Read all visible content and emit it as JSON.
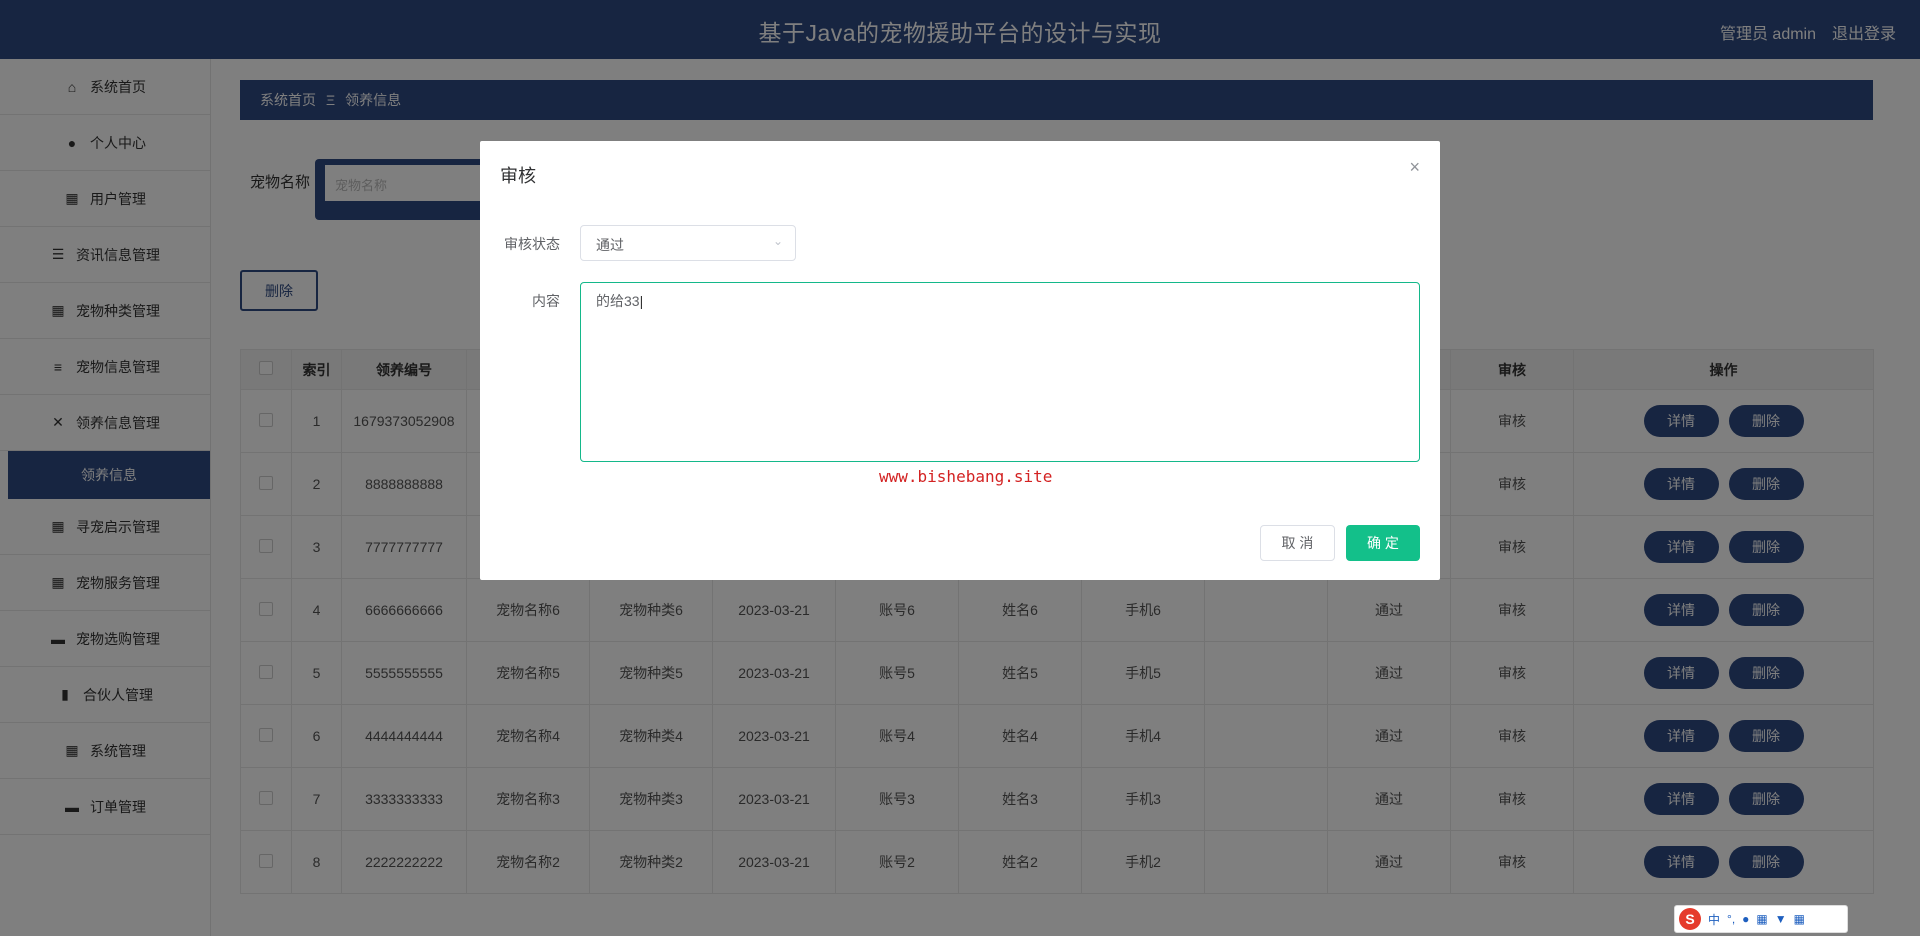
{
  "header": {
    "title": "基于Java的宠物援助平台的设计与实现",
    "user": "管理员 admin",
    "logout": "退出登录"
  },
  "sidebar": {
    "items": [
      {
        "label": "系统首页",
        "icon": "home-icon",
        "glyph": "⌂"
      },
      {
        "label": "个人中心",
        "icon": "user-icon",
        "glyph": "●"
      },
      {
        "label": "用户管理",
        "icon": "grid-icon",
        "glyph": "▦"
      },
      {
        "label": "资讯信息管理",
        "icon": "list-icon",
        "glyph": "☰"
      },
      {
        "label": "宠物种类管理",
        "icon": "grid-icon",
        "glyph": "▦"
      },
      {
        "label": "宠物信息管理",
        "icon": "sliders-icon",
        "glyph": "≡"
      },
      {
        "label": "领养信息管理",
        "icon": "ribbon-icon",
        "glyph": "✕"
      },
      {
        "label": "领养信息",
        "sub": true
      },
      {
        "label": "寻宠启示管理",
        "icon": "grid-icon",
        "glyph": "▦"
      },
      {
        "label": "宠物服务管理",
        "icon": "grid-icon",
        "glyph": "▦"
      },
      {
        "label": "宠物选购管理",
        "icon": "monitor-icon",
        "glyph": "▬"
      },
      {
        "label": "合伙人管理",
        "icon": "building-icon",
        "glyph": "▮"
      },
      {
        "label": "系统管理",
        "icon": "grid-icon",
        "glyph": "▦"
      },
      {
        "label": "订单管理",
        "icon": "doc-icon",
        "glyph": "▬"
      }
    ]
  },
  "breadcrumb": {
    "home": "系统首页",
    "sep": "Ξ",
    "current": "领养信息"
  },
  "search": {
    "label": "宠物名称",
    "placeholder": "宠物名称"
  },
  "toolbar": {
    "delete_label": "删除"
  },
  "table": {
    "headers": [
      "",
      "索引",
      "领养编号",
      "",
      "",
      "",
      "",
      "",
      "",
      "",
      "审核",
      "操作"
    ],
    "rows": [
      [
        "1",
        "1679373052908",
        "",
        "",
        "",
        "",
        "",
        "",
        "",
        "审核"
      ],
      [
        "2",
        "8888888888",
        "",
        "",
        "",
        "",
        "",
        "",
        "",
        "审核"
      ],
      [
        "3",
        "7777777777",
        "",
        "",
        "",
        "",
        "",
        "",
        "",
        "审核"
      ],
      [
        "4",
        "6666666666",
        "宠物名称6",
        "宠物种类6",
        "2023-03-21",
        "账号6",
        "姓名6",
        "手机6",
        "",
        "通过",
        "审核"
      ],
      [
        "5",
        "5555555555",
        "宠物名称5",
        "宠物种类5",
        "2023-03-21",
        "账号5",
        "姓名5",
        "手机5",
        "",
        "通过",
        "审核"
      ],
      [
        "6",
        "4444444444",
        "宠物名称4",
        "宠物种类4",
        "2023-03-21",
        "账号4",
        "姓名4",
        "手机4",
        "",
        "通过",
        "审核"
      ],
      [
        "7",
        "3333333333",
        "宠物名称3",
        "宠物种类3",
        "2023-03-21",
        "账号3",
        "姓名3",
        "手机3",
        "",
        "通过",
        "审核"
      ],
      [
        "8",
        "2222222222",
        "宠物名称2",
        "宠物种类2",
        "2023-03-21",
        "账号2",
        "姓名2",
        "手机2",
        "",
        "通过",
        "审核"
      ]
    ],
    "detail_label": "详情",
    "delete_label": "删除"
  },
  "dialog": {
    "title": "审核",
    "close": "×",
    "status_label": "审核状态",
    "status_value": "通过",
    "content_label": "内容",
    "content_value": "的给33",
    "watermark": "www.bishebang.site",
    "cancel": "取 消",
    "confirm": "确 定"
  },
  "ime": {
    "logo": "S",
    "lang": "中",
    "punct": "°,"
  }
}
